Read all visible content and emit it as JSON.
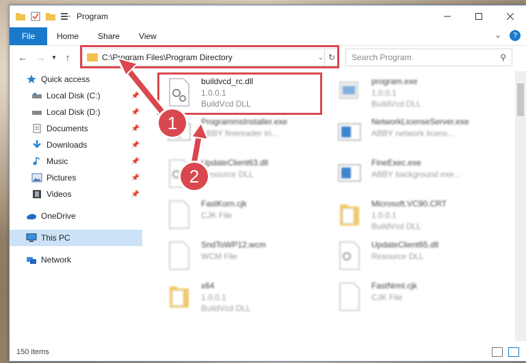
{
  "window": {
    "title": "Program",
    "controls": [
      "minimize",
      "maximize",
      "close"
    ]
  },
  "ribbon": {
    "tabs": [
      "File",
      "Home",
      "Share",
      "View"
    ]
  },
  "address": {
    "path": "C:\\Program Files\\Program Directory"
  },
  "search": {
    "placeholder": "Search Program"
  },
  "sidebar": {
    "items": [
      {
        "label": "Quick access",
        "icon": "star-icon"
      },
      {
        "label": "Local Disk (C:)",
        "icon": "drive-icon",
        "pinned": true
      },
      {
        "label": "Local Disk (D:)",
        "icon": "drive-icon",
        "pinned": true
      },
      {
        "label": "Documents",
        "icon": "documents-icon",
        "pinned": true
      },
      {
        "label": "Downloads",
        "icon": "downloads-icon",
        "pinned": true
      },
      {
        "label": "Music",
        "icon": "music-icon",
        "pinned": true
      },
      {
        "label": "Pictures",
        "icon": "pictures-icon",
        "pinned": true
      },
      {
        "label": "Videos",
        "icon": "videos-icon",
        "pinned": true
      },
      {
        "label": "OneDrive",
        "icon": "cloud-icon"
      },
      {
        "label": "This PC",
        "icon": "computer-icon",
        "selected": true
      },
      {
        "label": "Network",
        "icon": "network-icon"
      }
    ]
  },
  "files": [
    {
      "name": "buildvcd_rc.dll",
      "line2": "1.0.0.1",
      "line3": "BuildVcd DLL",
      "icon": "dll-icon"
    },
    {
      "name": "program.exe",
      "line2": "1.0.0.1",
      "line3": "BuildVcd DLL",
      "icon": "exe-icon"
    },
    {
      "name": "ProgrammsInstaller.exe",
      "line2": "ABBY finereader tri...",
      "line3": "",
      "icon": "exe-icon"
    },
    {
      "name": "NetworkLicenseServer.exe",
      "line2": "ABBY network licens...",
      "line3": "",
      "icon": "exe-icon"
    },
    {
      "name": "UpdateClient63.dll",
      "line2": "Resource DLL",
      "line3": "",
      "icon": "dll-icon"
    },
    {
      "name": "FineExec.exe",
      "line2": "ABBY background exe...",
      "line3": "",
      "icon": "exe-icon"
    },
    {
      "name": "FastKorn.cjk",
      "line2": "CJK File",
      "line3": "",
      "icon": "file-icon"
    },
    {
      "name": "Microsoft.VC90.CRT",
      "line2": "1.0.0.1",
      "line3": "BuildVcd DLL",
      "icon": "folder-icon"
    },
    {
      "name": "SndToWP12.wcm",
      "line2": "WCM File",
      "line3": "",
      "icon": "file-icon"
    },
    {
      "name": "UpdateClient65.dll",
      "line2": "Resource DLL",
      "line3": "",
      "icon": "dll-icon"
    },
    {
      "name": "x64",
      "line2": "1.0.0.1",
      "line3": "BuildVcd DLL",
      "icon": "folder-icon"
    },
    {
      "name": "FastNrml.cjk",
      "line2": "CJK File",
      "line3": "",
      "icon": "file-icon"
    }
  ],
  "status": {
    "items_count": "150 items"
  },
  "annotations": {
    "callouts": [
      "1",
      "2"
    ],
    "color": "#d9474f"
  }
}
